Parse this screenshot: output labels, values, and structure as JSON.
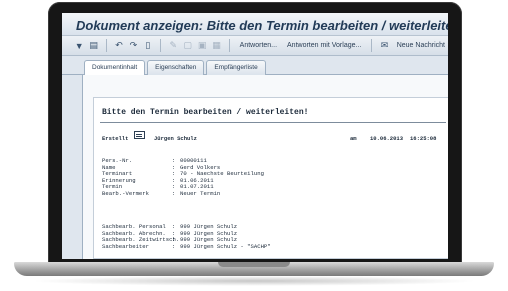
{
  "window": {
    "title": "Dokument anzeigen: Bitte den Termin bearbeiten / weiterleiten!"
  },
  "toolbar": {
    "antworten": "Antworten...",
    "antworten_vorlage": "Antworten mit Vorlage...",
    "neue_nachricht": "Neue Nachricht"
  },
  "tabs": [
    {
      "label": "Dokumentinhalt",
      "active": true
    },
    {
      "label": "Eigenschaften",
      "active": false
    },
    {
      "label": "Empfängerliste",
      "active": false
    }
  ],
  "document": {
    "heading": "Bitte den Termin bearbeiten / weiterleiten!",
    "created_label": "Erstellt",
    "created_by": "Jürgen Schulz",
    "date_prefix": "am",
    "date": "10.06.2013",
    "time": "16:25:08",
    "fields": [
      {
        "label": "Pers.-Nr.",
        "value": "00000111"
      },
      {
        "label": "Name",
        "value": "Gerd Volkers"
      },
      {
        "label": "Terminart",
        "value": "70 - Naechste Beurteilung"
      },
      {
        "label": "Erinnerung",
        "value": "01.06.2011"
      },
      {
        "label": "Termin",
        "value": "01.07.2011"
      },
      {
        "label": "Bearb.-Vermerk",
        "value": "Neuer Termin"
      }
    ],
    "fields2": [
      {
        "label": "Sachbearb. Personal",
        "value": "999 Jürgen Schulz"
      },
      {
        "label": "Sachbearb. Abrechn.",
        "value": "999 Jürgen Schulz"
      },
      {
        "label": "Sachbearb. Zeitwirtsch.",
        "value": "999 Jürgen Schulz"
      },
      {
        "label": "Sachbearbeiter",
        "value": "999 Jürgen Schulz - \"SACHP\""
      }
    ]
  }
}
